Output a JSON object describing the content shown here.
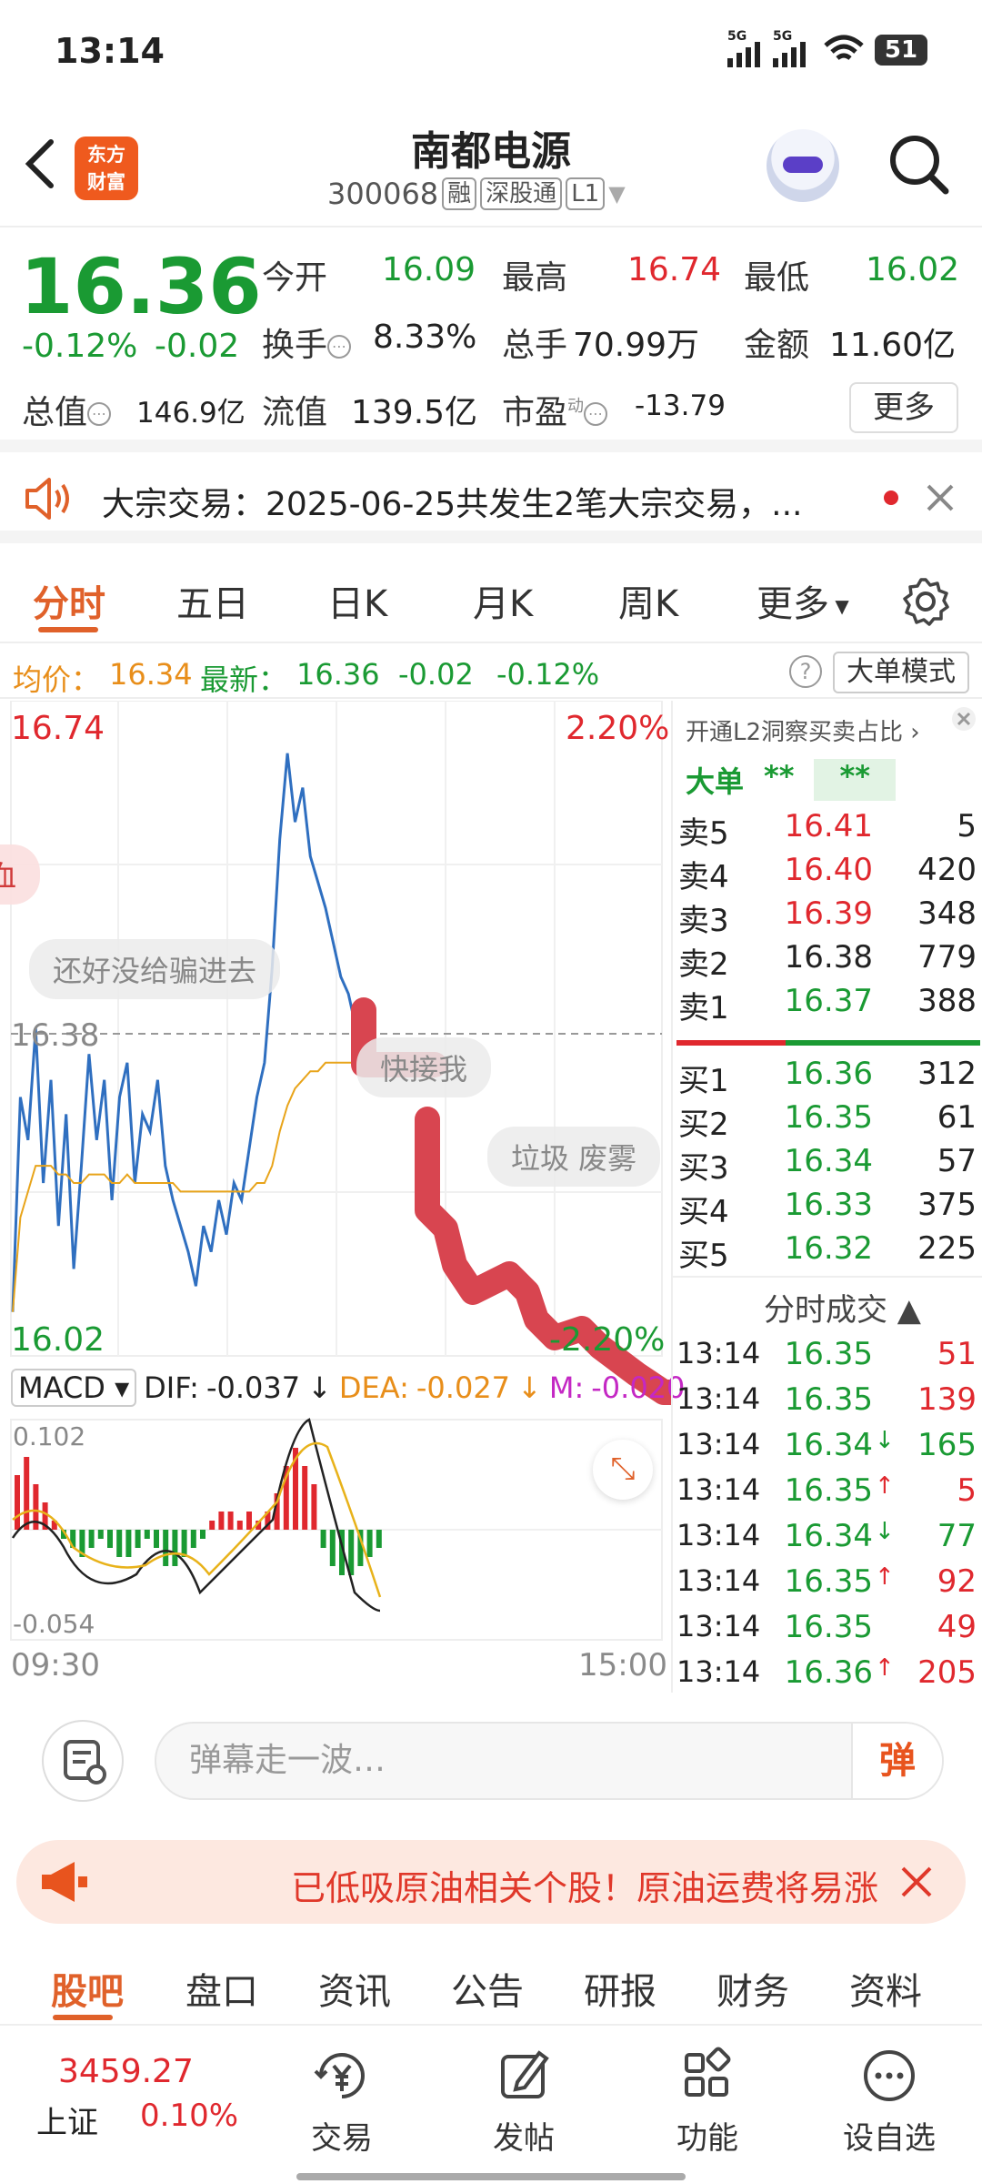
{
  "status_bar": {
    "time": "13:14",
    "net1": "5G",
    "net2": "5G",
    "battery": "51"
  },
  "header": {
    "name": "南都电源",
    "code": "300068",
    "tags": [
      "融",
      "深股通",
      "L1"
    ],
    "logo": [
      "东方",
      "财富"
    ]
  },
  "quote": {
    "price": "16.36",
    "pct": "-0.12%",
    "chg": "-0.02",
    "open_label": "今开",
    "open": "16.09",
    "high_label": "最高",
    "high": "16.74",
    "low_label": "最低",
    "low": "16.02",
    "turnover_label": "换手",
    "turnover": "8.33%",
    "volume_label": "总手",
    "volume": "70.99万",
    "amount_label": "金额",
    "amount": "11.60亿",
    "mktcap_label": "总值",
    "mktcap": "146.9亿",
    "float_label": "流值",
    "float": "139.5亿",
    "pe_label": "市盈",
    "pe_sup": "动",
    "pe": "-13.79",
    "more": "更多"
  },
  "news": {
    "text": "大宗交易：2025-06-25共发生2笔大宗交易，..."
  },
  "tabs": [
    "分时",
    "五日",
    "日K",
    "月K",
    "周K",
    "更多"
  ],
  "avg_bar": {
    "avg_label": "均价：",
    "avg": "16.34",
    "last_label": "最新：",
    "last": "16.36",
    "chg": "-0.02",
    "pct": "-0.12%",
    "mode": "大单模式"
  },
  "chart_data": {
    "type": "line",
    "title": "",
    "price_high": "16.74",
    "price_low": "16.02",
    "pct_high": "2.20%",
    "pct_low": "-2.20%",
    "prev_close": "16.38",
    "x_start": "09:30",
    "x_end": "15:00",
    "ylim": [
      16.02,
      16.74
    ],
    "series": [
      {
        "values": [
          16.05,
          16.3,
          16.25,
          16.38,
          16.2,
          16.32,
          16.15,
          16.28,
          16.1,
          16.22,
          16.35,
          16.25,
          16.32,
          16.18,
          16.3,
          16.34,
          16.2,
          16.28,
          16.26,
          16.32,
          16.22,
          16.18,
          16.15,
          16.12,
          16.08,
          16.15,
          16.12,
          16.18,
          16.14,
          16.2,
          16.18,
          16.24,
          16.3,
          16.34,
          16.45,
          16.6,
          16.7,
          16.62,
          16.66,
          16.58,
          16.55,
          16.52,
          16.48,
          16.44,
          16.42,
          16.38,
          16.36
        ]
      },
      {
        "values": [
          16.05,
          16.16,
          16.19,
          16.22,
          16.22,
          16.22,
          16.21,
          16.21,
          16.2,
          16.2,
          16.21,
          16.21,
          16.21,
          16.2,
          16.2,
          16.21,
          16.2,
          16.2,
          16.2,
          16.2,
          16.2,
          16.2,
          16.19,
          16.19,
          16.19,
          16.19,
          16.19,
          16.19,
          16.19,
          16.19,
          16.19,
          16.19,
          16.2,
          16.2,
          16.22,
          16.26,
          16.29,
          16.31,
          16.32,
          16.33,
          16.33,
          16.34,
          16.34,
          16.34,
          16.34,
          16.34,
          16.34
        ]
      }
    ],
    "macd": {
      "label": "MACD",
      "dif_label": "DIF:",
      "dif": "-0.037",
      "dea_label": "DEA:",
      "dea": "-0.027",
      "m_label": "M:",
      "m": "-0.020",
      "ymax": "0.102",
      "ymin": "-0.054",
      "hist": [
        0.06,
        0.08,
        0.05,
        0.03,
        0.01,
        -0.01,
        -0.02,
        -0.03,
        -0.02,
        -0.01,
        -0.02,
        -0.03,
        -0.03,
        -0.02,
        -0.01,
        -0.02,
        -0.04,
        -0.04,
        -0.03,
        -0.02,
        -0.01,
        0.01,
        0.02,
        0.02,
        0.01,
        0.02,
        0.01,
        0.02,
        0.04,
        0.07,
        0.09,
        0.07,
        0.05,
        -0.02,
        -0.04,
        -0.05,
        -0.05,
        -0.04,
        -0.03,
        -0.02
      ]
    }
  },
  "overlay_bubbles": [
    "血",
    "还好没给骗进去",
    "快接我",
    "垃圾 废雾"
  ],
  "orderbook": {
    "promo": "开通L2洞察买卖占比",
    "bigorder_label": "大单",
    "bigorder_a": "**",
    "bigorder_b": "**",
    "asks": [
      {
        "label": "卖5",
        "price": "16.41",
        "vol": "5",
        "color": "#e0282e"
      },
      {
        "label": "卖4",
        "price": "16.40",
        "vol": "420",
        "color": "#e0282e"
      },
      {
        "label": "卖3",
        "price": "16.39",
        "vol": "348",
        "color": "#e0282e"
      },
      {
        "label": "卖2",
        "price": "16.38",
        "vol": "779",
        "color": "#222222"
      },
      {
        "label": "卖1",
        "price": "16.37",
        "vol": "388",
        "color": "#1a9a33"
      }
    ],
    "bids": [
      {
        "label": "买1",
        "price": "16.36",
        "vol": "312",
        "color": "#1a9a33"
      },
      {
        "label": "买2",
        "price": "16.35",
        "vol": "61",
        "color": "#1a9a33"
      },
      {
        "label": "买3",
        "price": "16.34",
        "vol": "57",
        "color": "#1a9a33"
      },
      {
        "label": "买4",
        "price": "16.33",
        "vol": "375",
        "color": "#1a9a33"
      },
      {
        "label": "买5",
        "price": "16.32",
        "vol": "225",
        "color": "#1a9a33"
      }
    ],
    "ticks_label": "分时成交",
    "ticks": [
      {
        "t": "13:14",
        "p": "16.35",
        "arrow": "",
        "v": "51",
        "vc": "#e0282e"
      },
      {
        "t": "13:14",
        "p": "16.35",
        "arrow": "",
        "v": "139",
        "vc": "#e0282e"
      },
      {
        "t": "13:14",
        "p": "16.34",
        "arrow": "↓",
        "v": "165",
        "vc": "#1a9a33"
      },
      {
        "t": "13:14",
        "p": "16.35",
        "arrow": "↑",
        "v": "5",
        "vc": "#e0282e"
      },
      {
        "t": "13:14",
        "p": "16.34",
        "arrow": "↓",
        "v": "77",
        "vc": "#1a9a33"
      },
      {
        "t": "13:14",
        "p": "16.35",
        "arrow": "↑",
        "v": "92",
        "vc": "#e0282e"
      },
      {
        "t": "13:14",
        "p": "16.35",
        "arrow": "",
        "v": "49",
        "vc": "#e0282e"
      },
      {
        "t": "13:14",
        "p": "16.36",
        "arrow": "↑",
        "v": "205",
        "vc": "#e0282e"
      }
    ]
  },
  "danmu": {
    "placeholder": "弹幕走一波…",
    "send": "弹"
  },
  "promo": {
    "text": "已低吸原油相关个股！原油运费将易涨"
  },
  "subtabs": [
    "股吧",
    "盘口",
    "资讯",
    "公告",
    "研报",
    "财务",
    "资料"
  ],
  "bottom_nav": {
    "index_value": "3459.27",
    "index_name": "上证",
    "index_pct": "0.10%",
    "items": [
      "交易",
      "发帖",
      "功能",
      "设自选"
    ]
  },
  "colors": {
    "up": "#e0282e",
    "down": "#1a9a33",
    "accent": "#e0612a",
    "avg_line": "#e8a41a",
    "price_line": "#2f6fc0"
  }
}
